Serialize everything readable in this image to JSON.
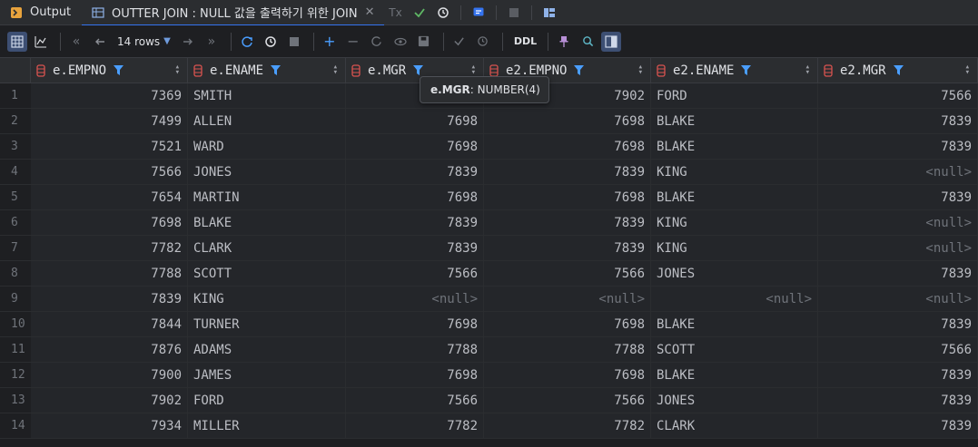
{
  "tabs": [
    {
      "label": "Output",
      "active": false,
      "icon": "output-icon"
    },
    {
      "label": "OUTTER JOIN : NULL 값을 출력하기 위한 JOIN",
      "active": true,
      "icon": "table-icon",
      "closable": true
    }
  ],
  "tab_tools": {
    "tx_label": "Tx"
  },
  "toolbar": {
    "rows_label": "14 rows",
    "ddl_label": "DDL"
  },
  "grid": {
    "columns": [
      {
        "name": "e.EMPNO",
        "align": "right"
      },
      {
        "name": "e.ENAME",
        "align": "left"
      },
      {
        "name": "e.MGR",
        "align": "right"
      },
      {
        "name": "e2.EMPNO",
        "align": "right"
      },
      {
        "name": "e2.ENAME",
        "align": "left"
      },
      {
        "name": "e2.MGR",
        "align": "right"
      }
    ],
    "rows": [
      [
        "7369",
        "SMITH",
        "7902",
        "7902",
        "FORD",
        "7566"
      ],
      [
        "7499",
        "ALLEN",
        "7698",
        "7698",
        "BLAKE",
        "7839"
      ],
      [
        "7521",
        "WARD",
        "7698",
        "7698",
        "BLAKE",
        "7839"
      ],
      [
        "7566",
        "JONES",
        "7839",
        "7839",
        "KING",
        "<null>"
      ],
      [
        "7654",
        "MARTIN",
        "7698",
        "7698",
        "BLAKE",
        "7839"
      ],
      [
        "7698",
        "BLAKE",
        "7839",
        "7839",
        "KING",
        "<null>"
      ],
      [
        "7782",
        "CLARK",
        "7839",
        "7839",
        "KING",
        "<null>"
      ],
      [
        "7788",
        "SCOTT",
        "7566",
        "7566",
        "JONES",
        "7839"
      ],
      [
        "7839",
        "KING",
        "<null>",
        "<null>",
        "<null>",
        "<null>"
      ],
      [
        "7844",
        "TURNER",
        "7698",
        "7698",
        "BLAKE",
        "7839"
      ],
      [
        "7876",
        "ADAMS",
        "7788",
        "7788",
        "SCOTT",
        "7566"
      ],
      [
        "7900",
        "JAMES",
        "7698",
        "7698",
        "BLAKE",
        "7839"
      ],
      [
        "7902",
        "FORD",
        "7566",
        "7566",
        "JONES",
        "7839"
      ],
      [
        "7934",
        "MILLER",
        "7782",
        "7782",
        "CLARK",
        "7839"
      ]
    ]
  },
  "tooltip": {
    "column": "e.MGR",
    "type": ": NUMBER(4)"
  },
  "colors": {
    "accent": "#3574f0",
    "filter": "#4a9eff",
    "column_icon": "#d9534f"
  }
}
